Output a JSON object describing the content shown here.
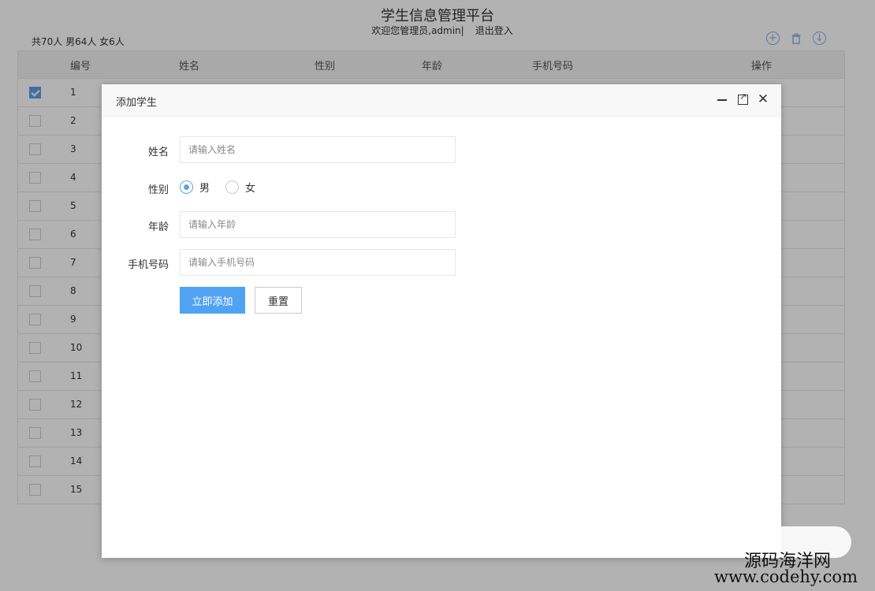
{
  "header": {
    "title": "学生信息管理平台",
    "welcome": "欢迎您管理员,admin|",
    "logout": "退出登入",
    "counts": "共70人 男64人 女6人"
  },
  "toolbar": {
    "add_icon": "plus-circle-icon",
    "delete_icon": "trash-icon",
    "download_icon": "download-circle-icon"
  },
  "table": {
    "columns": [
      "编号",
      "姓名",
      "性别",
      "年龄",
      "手机号码",
      "操作"
    ],
    "rows": [
      "1",
      "2",
      "3",
      "4",
      "5",
      "6",
      "7",
      "8",
      "9",
      "10",
      "11",
      "12",
      "13",
      "14",
      "15"
    ],
    "checked_row": "1"
  },
  "dialog": {
    "title": "添加学生",
    "fields": {
      "name_label": "姓名",
      "name_placeholder": "请输入姓名",
      "gender_label": "性别",
      "gender_male": "男",
      "gender_female": "女",
      "gender_selected": "男",
      "age_label": "年龄",
      "age_placeholder": "请输入年龄",
      "phone_label": "手机号码",
      "phone_placeholder": "请输入手机号码"
    },
    "submit_label": "立即添加",
    "reset_label": "重置"
  },
  "watermark": {
    "line1": "源码海洋网",
    "line2": "www.codehy.com"
  },
  "colors": {
    "accent": "#4fa3f2",
    "checkbox": "#5fa0e6",
    "overlay": "rgba(0,0,0,0.3)"
  }
}
